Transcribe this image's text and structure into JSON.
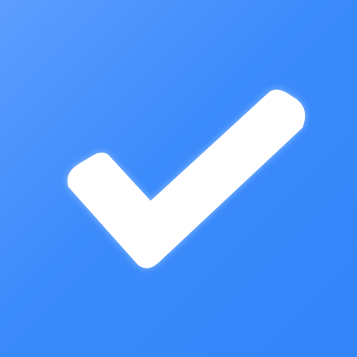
{
  "icon": {
    "name": "checkmark-icon",
    "background_colors": [
      "#5D9DFE",
      "#3C8BFB",
      "#3385FA"
    ],
    "check_color": "#FFFFFF",
    "glow_color": "#DDEBFF"
  }
}
